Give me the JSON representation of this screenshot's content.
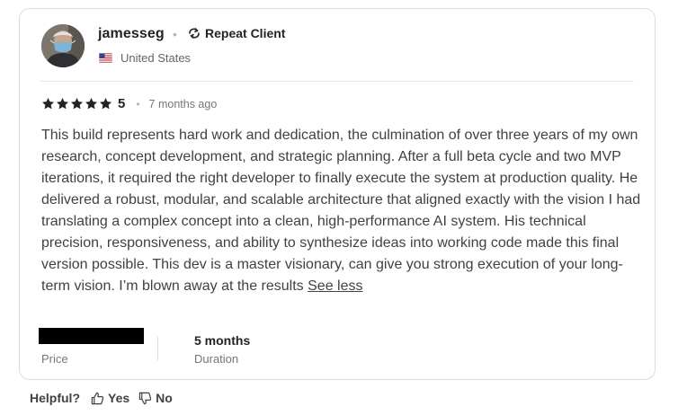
{
  "reviewer": {
    "username": "jamesseg",
    "badge": "Repeat Client",
    "country": "United States"
  },
  "rating": {
    "score": "5",
    "stars": 5,
    "time_ago": "7 months ago"
  },
  "review": {
    "text": "This build represents hard work and dedication, the culmination of over three years of my own research, concept development, and strategic planning. After a full beta cycle and two MVP iterations, it required the right developer to finally execute the system at production quality. He delivered a robust, modular, and scalable architecture that aligned exactly with the vision I had translating a complex concept into a clean, high-performance AI system. His technical precision, responsiveness, and ability to synthesize ideas into working code made this final version possible. This dev is a master visionary, can give you strong execution of your long-term vision. I’m blown away at the results",
    "toggle_label": "See less"
  },
  "meta": {
    "price_label": "Price",
    "duration_value": "5 months",
    "duration_label": "Duration"
  },
  "feedback": {
    "question": "Helpful?",
    "yes_label": "Yes",
    "no_label": "No"
  },
  "icons": {
    "star": "star-icon",
    "repeat": "repeat-icon",
    "flag": "us-flag-icon",
    "thumbs_up": "thumbs-up-icon",
    "thumbs_down": "thumbs-down-icon"
  },
  "colors": {
    "star": "#222325",
    "text": "#404145",
    "muted": "#74767e",
    "border": "#dadbdd"
  }
}
